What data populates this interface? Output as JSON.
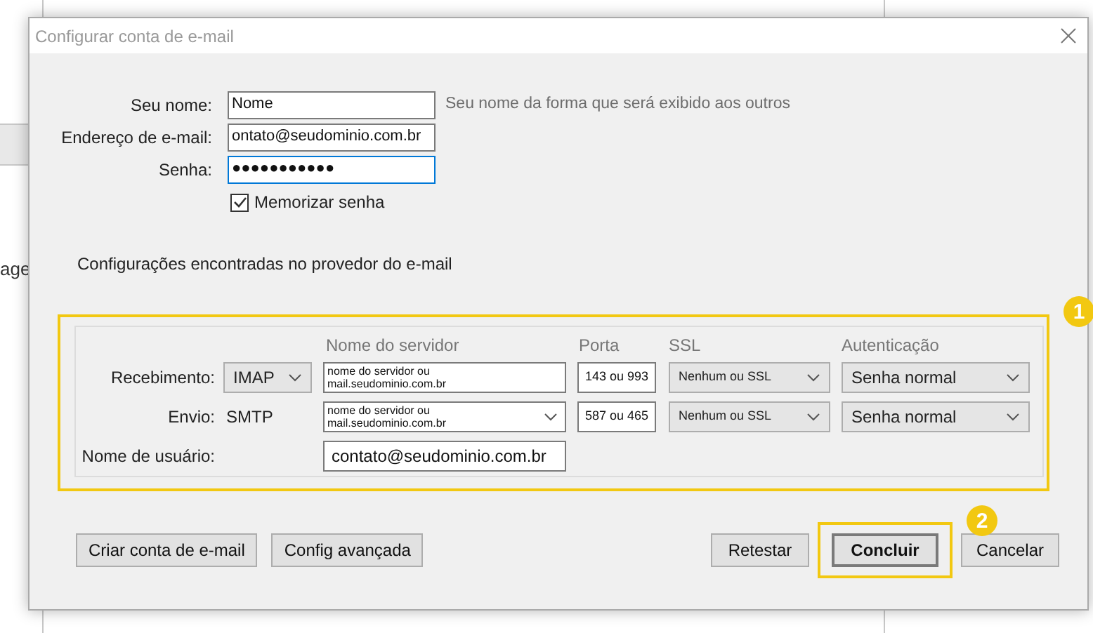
{
  "background_window": {
    "fragment": "age"
  },
  "dialog": {
    "title": "Configurar conta de e-mail"
  },
  "identity": {
    "fields": [
      {
        "label": "Seu nome:",
        "value": "Nome",
        "focused": false
      },
      {
        "label": "Endereço de e-mail:",
        "value": "ontato@seudominio.com.br",
        "focused": false
      },
      {
        "label": "Senha:",
        "value": "●●●●●●●●●●●",
        "focused": true
      }
    ],
    "hint": "Seu nome da forma que será exibido aos outros",
    "remember": {
      "label": "Memorizar senha",
      "checked": true
    }
  },
  "status_text": "Configurações encontradas no provedor do e-mail",
  "server_table": {
    "columns": [
      "Nome do servidor",
      "Porta",
      "SSL",
      "Autenticação"
    ],
    "rows": [
      {
        "label": "Recebimento:",
        "protocol": {
          "kind": "select",
          "value": "IMAP"
        },
        "server": {
          "value": "nome do servidor ou mail.seudominio.com.br",
          "dropdown": false
        },
        "port": "143 ou 993",
        "ssl": "Nenhum ou SSL",
        "auth": "Senha normal"
      },
      {
        "label": "Envio:",
        "protocol": {
          "kind": "text",
          "value": "SMTP"
        },
        "server": {
          "value": "nome do servidor ou mail.seudominio.com.br",
          "dropdown": true
        },
        "port": "587 ou 465",
        "ssl": "Nenhum ou SSL",
        "auth": "Senha normal"
      }
    ],
    "username": {
      "label": "Nome de usuário:",
      "value": "contato@seudominio.com.br"
    }
  },
  "callouts": [
    {
      "number": "1"
    },
    {
      "number": "2"
    }
  ],
  "buttons_left": [
    "Criar conta de e-mail",
    "Config avançada"
  ],
  "buttons_right": [
    {
      "label": "Retestar",
      "default": false,
      "highlighted": false
    },
    {
      "label": "Concluir",
      "default": true,
      "highlighted": true
    },
    {
      "label": "Cancelar",
      "default": false,
      "highlighted": false
    }
  ]
}
